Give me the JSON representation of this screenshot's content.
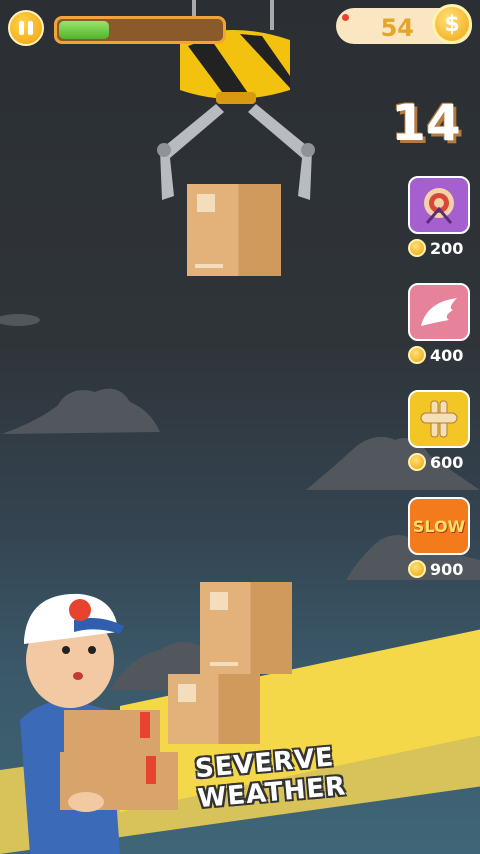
{
  "hud": {
    "coins": "54",
    "coin_symbol": "$",
    "score": "14",
    "progress": 0.3
  },
  "powerups": [
    {
      "name": "target",
      "price": "200",
      "color": "#a55fcf"
    },
    {
      "name": "wing",
      "price": "400",
      "color": "#e7829b"
    },
    {
      "name": "magnet",
      "price": "600",
      "color": "#f2c624"
    },
    {
      "name": "slow",
      "label": "SLOW",
      "price": "900",
      "color": "#f37b1c"
    }
  ],
  "banner": {
    "text": "SEVERVE WEATHER"
  }
}
